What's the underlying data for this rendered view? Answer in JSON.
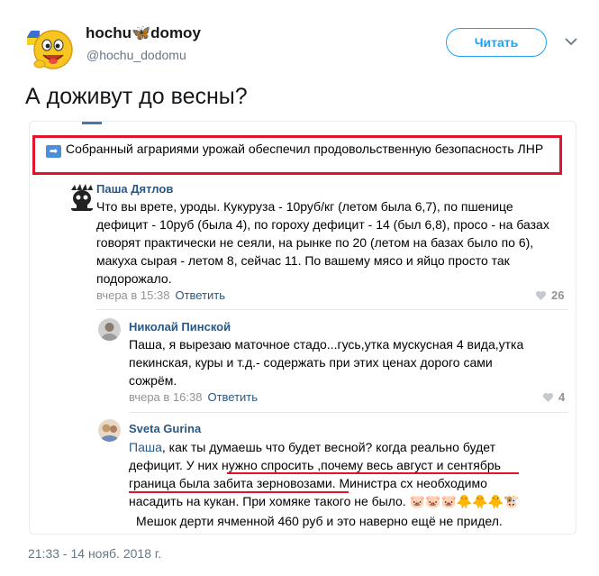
{
  "author": {
    "name_part1": "hochu",
    "name_part2": "domoy",
    "handle": "@hochu_dodomu",
    "follow_label": "Читать"
  },
  "tweet": {
    "text": "А доживут до весны?",
    "timestamp": "21:33 - 14 нояб. 2018 г."
  },
  "screenshot": {
    "post_text": "Собранный аграриями урожай обеспечил продовольственную безопасность ЛНР",
    "comments": [
      {
        "author": "Паша Дятлов",
        "lines": [
          "Что вы врете, уроды. Кукуруза - 10руб/кг (летом была 6,7), по пшенице",
          "дефицит - 10руб (была 4), по гороху дефицит - 14 (был 6,8), просо - на базах",
          "говорят практически не сеяли, на рынке по 20 (летом на базах было по 6),",
          "макуха сырая - летом 8, сейчас 11. По вашему мясо и яйцо просто так",
          "подорожало."
        ],
        "time": "вчера в 15:38",
        "reply": "Ответить",
        "likes": "26"
      },
      {
        "author": "Николай Пинской",
        "lines": [
          "Паша, я вырезаю маточное стадо...гусь,утка мускусная 4 вида,утка",
          "пекинская, куры и т.д.- содержать при этих ценах дорого сами",
          "сожрём."
        ],
        "time": "вчера в 16:38",
        "reply": "Ответить",
        "likes": "4"
      },
      {
        "author": "Sveta Gurina",
        "mention": "Паша",
        "line1_rest": ", как ты думаешь что будет весной? когда реально будет",
        "line2": "дефицит. У них нужно спросить ,почему весь август и сентябрь",
        "line3": "граница была забита зерновозами. Министра сх необходимо",
        "line4": "насадить на кукан. При хомяке такого не было.",
        "line5": "Мешок дерти ячменной 460 руб и это наверно ещё не придел."
      }
    ]
  },
  "colors": {
    "twitter_blue": "#1da1f2",
    "vk_blue": "#2a5885",
    "highlight_red": "#e0142c"
  }
}
